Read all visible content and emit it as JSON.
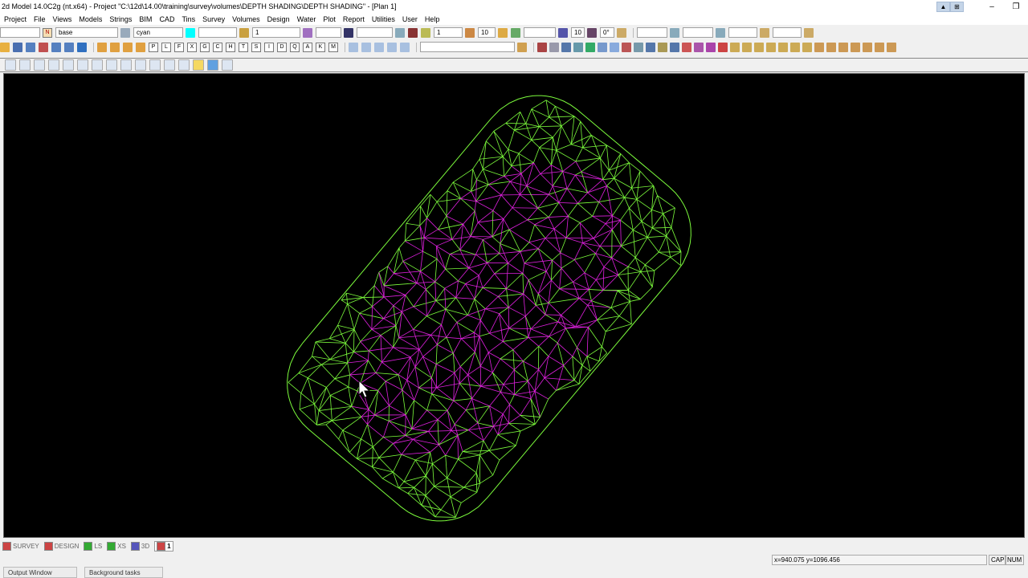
{
  "title": "2d Model  14.0C2g (nt.x64) - Project \"C:\\12d\\14.00\\training\\survey\\volumes\\DEPTH SHADING\\DEPTH SHADING\" - [Plan 1]",
  "menu": [
    "Project",
    "File",
    "Views",
    "Models",
    "Strings",
    "BIM",
    "CAD",
    "Tins",
    "Survey",
    "Volumes",
    "Design",
    "Water",
    "Plot",
    "Report",
    "Utilities",
    "User",
    "Help"
  ],
  "toolbar1": {
    "model": "base",
    "colour": "cyan",
    "colour_swatch": "#00ffff",
    "weight": "1",
    "text_size": "1",
    "text_height": "10",
    "size2": "10",
    "angle": "0°"
  },
  "toolbar2_letters": [
    "P",
    "L",
    "F",
    "X",
    "G",
    "C",
    "H",
    "T",
    "S",
    "I",
    "D",
    "Q",
    "A",
    "K",
    "M"
  ],
  "tabs": [
    "SURVEY",
    "DESIGN",
    "LS",
    "XS",
    "3D",
    "1"
  ],
  "status": {
    "output_window": "Output Window",
    "background_tasks": "Background tasks",
    "coords": "x=940.075 y=1096.456",
    "cap": "CAP",
    "num": "NUM"
  },
  "colors": {
    "outer_mesh": "#7cfc3c",
    "inner_mesh": "#e020e0",
    "background": "#000000"
  }
}
